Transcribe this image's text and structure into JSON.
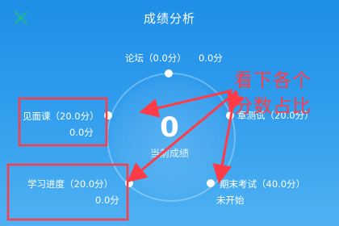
{
  "header": {
    "title": "成绩分析",
    "close_icon": "close-x-icon",
    "close_color": "#1fb88a"
  },
  "summary": {
    "score": "0",
    "label": "当前成绩"
  },
  "items": {
    "forum": {
      "name": "论坛（0.0分）",
      "score": "0.0分"
    },
    "lecture": {
      "name": "见面课（20.0分）",
      "score": "0.0分"
    },
    "quiz": {
      "name": "章测试（20.0分）"
    },
    "progress": {
      "name": "学习进度（20.0分）",
      "score": "0.0分"
    },
    "final_exam": {
      "name": "期末考试（40.0分）",
      "status": "未开始"
    }
  },
  "annotation": {
    "line1": "看下各个",
    "line2": "分数占比",
    "color": "#ff3b47"
  }
}
